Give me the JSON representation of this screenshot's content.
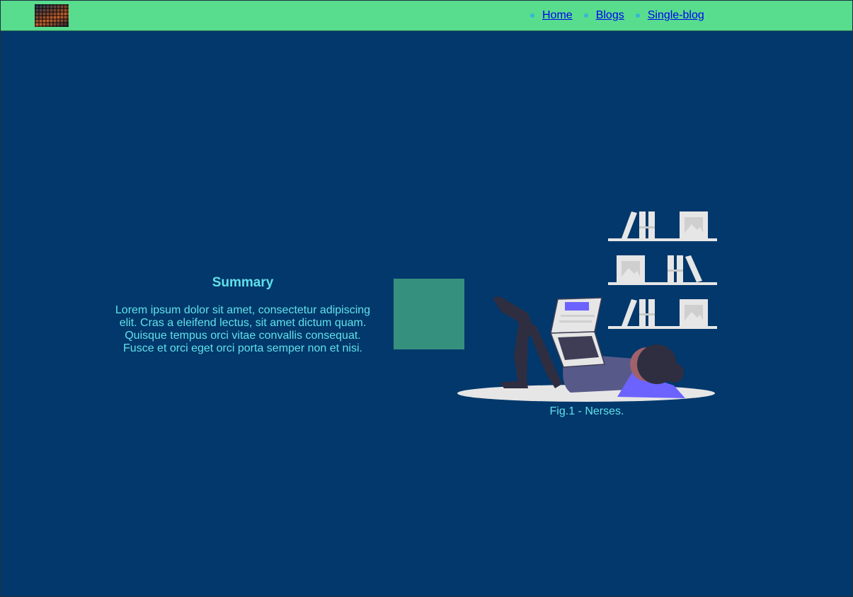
{
  "nav": {
    "logo_alt": "keyboard logo",
    "links": [
      {
        "label": "Home"
      },
      {
        "label": "Blogs"
      },
      {
        "label": "Single-blog"
      }
    ]
  },
  "summary": {
    "title": "Summary",
    "lines": [
      "Lorem ipsum dolor sit amet, consectetur adipiscing",
      "elit. Cras a eleifend lectus, sit amet dictum quam.",
      "Quisque tempus orci vitae convallis consequat.",
      "Fusce et orci eget orci porta semper non et nisi."
    ]
  },
  "figure": {
    "caption": "Fig.1 - Nerses."
  },
  "colors": {
    "background": "#02386b",
    "navbar": "#58dc8e",
    "accent_text": "#60e0ea",
    "teal_box": "#35917e"
  }
}
